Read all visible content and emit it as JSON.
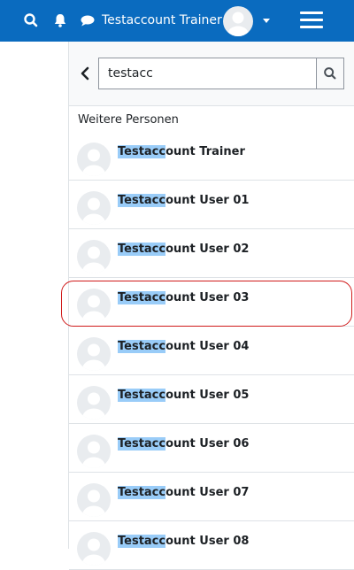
{
  "navbar": {
    "user_name": "Testaccount Trainer",
    "icons": [
      "search-icon",
      "bell-icon",
      "chat-icon",
      "avatar",
      "caret-down-icon",
      "hamburger-icon"
    ],
    "background_color": "#0a6bbf"
  },
  "search": {
    "value": "testacc",
    "placeholder": ""
  },
  "section": {
    "title": "Weitere Personen"
  },
  "results": [
    {
      "match": "Testacc",
      "rest": "ount Trainer"
    },
    {
      "match": "Testacc",
      "rest": "ount User 01"
    },
    {
      "match": "Testacc",
      "rest": "ount User 02"
    },
    {
      "match": "Testacc",
      "rest": "ount User 03"
    },
    {
      "match": "Testacc",
      "rest": "ount User 04"
    },
    {
      "match": "Testacc",
      "rest": "ount User 05"
    },
    {
      "match": "Testacc",
      "rest": "ount User 06"
    },
    {
      "match": "Testacc",
      "rest": "ount User 07"
    },
    {
      "match": "Testacc",
      "rest": "ount User 08"
    }
  ],
  "highlight_color": "#99ccf8",
  "selection_outline_color": "#d01b1b"
}
